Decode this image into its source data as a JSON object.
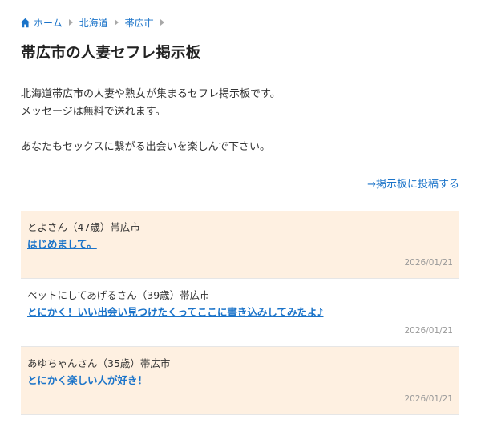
{
  "breadcrumb": {
    "items": [
      {
        "label": "ホーム",
        "icon": "home-icon"
      },
      {
        "label": "北海道"
      },
      {
        "label": "帯広市"
      }
    ]
  },
  "page": {
    "title": "帯広市の人妻セフレ掲示板",
    "intro_line1": "北海道帯広市の人妻や熟女が集まるセフレ掲示板です。",
    "intro_line2": "メッセージは無料で送れます。",
    "intro_line3": "あなたもセックスに繋がる出会いを楽しんで下さい。",
    "post_link": "→掲示板に投稿する"
  },
  "posts": [
    {
      "author": "とよさん（47歳）帯広市",
      "message": "はじめまして。",
      "date": "2026/01/21"
    },
    {
      "author": "ペットにしてあげるさん（39歳）帯広市",
      "message": "とにかく！いい出会い見つけたくってここに書き込みしてみたよ♪",
      "date": "2026/01/21"
    },
    {
      "author": "あゆちゃんさん（35歳）帯広市",
      "message": "とにかく楽しい人が好き！",
      "date": "2026/01/21"
    }
  ],
  "colors": {
    "link": "#1a73c9",
    "alt_row": "#fef0e1"
  }
}
